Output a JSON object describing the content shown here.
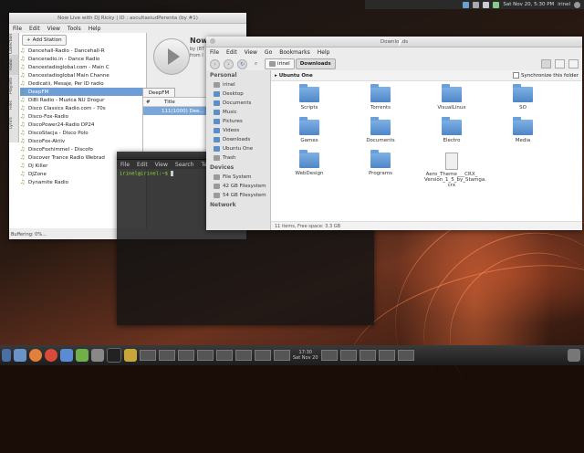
{
  "top_panel": {
    "datetime": "Sat Nov 20, 5:30 PM",
    "user": "irinel"
  },
  "player": {
    "title": "Now Live with DJ Ricky | ID : ascultasiudPerenta (by #1)",
    "menu": [
      "File",
      "Edit",
      "View",
      "Tools",
      "Help"
    ],
    "vertical_tabs": [
      "Collection",
      "Radio",
      "Playlists",
      "Files",
      "Lyrics"
    ],
    "add_station": "Add Station",
    "stations": [
      "Dancehall-Radio - Dancehall-R",
      "Danceradio.in - Dance Radio",
      "Dancestadioglobal.com - Main C",
      "Dancestadioglobal Main Channe",
      "Dedicatii, Mesaje, Per ID radio",
      "DeepFM",
      "DiBi Radio - Muzica NU Drogur",
      "Disco Classics Radio.com - 70s",
      "Disco-Fox-Radio",
      "DiscoPower24-Radio   DP24",
      "DiscoStacja - Disco Polo",
      "DiscoFox-Aktiv",
      "DiscoFoxhimmel - Discofo",
      "Discover Trance Radio Webrad",
      "Dj Killer",
      "DJZone",
      "Dynamite Radio"
    ],
    "selected_station_index": 5,
    "now_heading": "Now",
    "now_by": "by (BT",
    "now_from": "from I",
    "open_tab": "DeepFM",
    "table_headers": [
      "#",
      "Title"
    ],
    "table_rows": [
      [
        "1",
        "111(1000) Dee..."
      ]
    ],
    "status": "Buffering: 0%..."
  },
  "terminal": {
    "menu": [
      "File",
      "Edit",
      "View",
      "Search",
      "Ter"
    ],
    "prompt": "irinel@irinel:~$"
  },
  "file_manager": {
    "title": "Downloads",
    "menu": [
      "File",
      "Edit",
      "View",
      "Go",
      "Bookmarks",
      "Help"
    ],
    "breadcrumbs": [
      "irinel",
      "Downloads"
    ],
    "sidebar": {
      "personal_heading": "Personal",
      "personal": [
        "irinel",
        "Desktop",
        "Documents",
        "Music",
        "Pictures",
        "Videos",
        "Downloads",
        "Ubuntu One",
        "Trash"
      ],
      "devices_heading": "Devices",
      "devices": [
        "File System",
        "42 GB Filesystem",
        "54 GB Filesystem"
      ],
      "network_heading": "Network"
    },
    "location_label": "Ubuntu One",
    "sync_label": "Synchronize this folder",
    "items": [
      "Scripts",
      "Torrents",
      "VisualLinux",
      "SO",
      "Games",
      "Documents",
      "Electro",
      "Media",
      "WebDesign",
      "Programs",
      "Aero_Theme___CRX_\nVersion_1_5_by_Stamga.\ncrx"
    ],
    "status": "11 items, Free space: 3.3 GB"
  },
  "taskbar": {
    "clock_time": "17:30",
    "clock_date": "Sat Nov 20"
  },
  "colors": {
    "selection": "#6d9ed8",
    "folder": "#5f95d2",
    "prompt_green": "#8ae234",
    "wallpaper_accent": "#d86a3c"
  }
}
